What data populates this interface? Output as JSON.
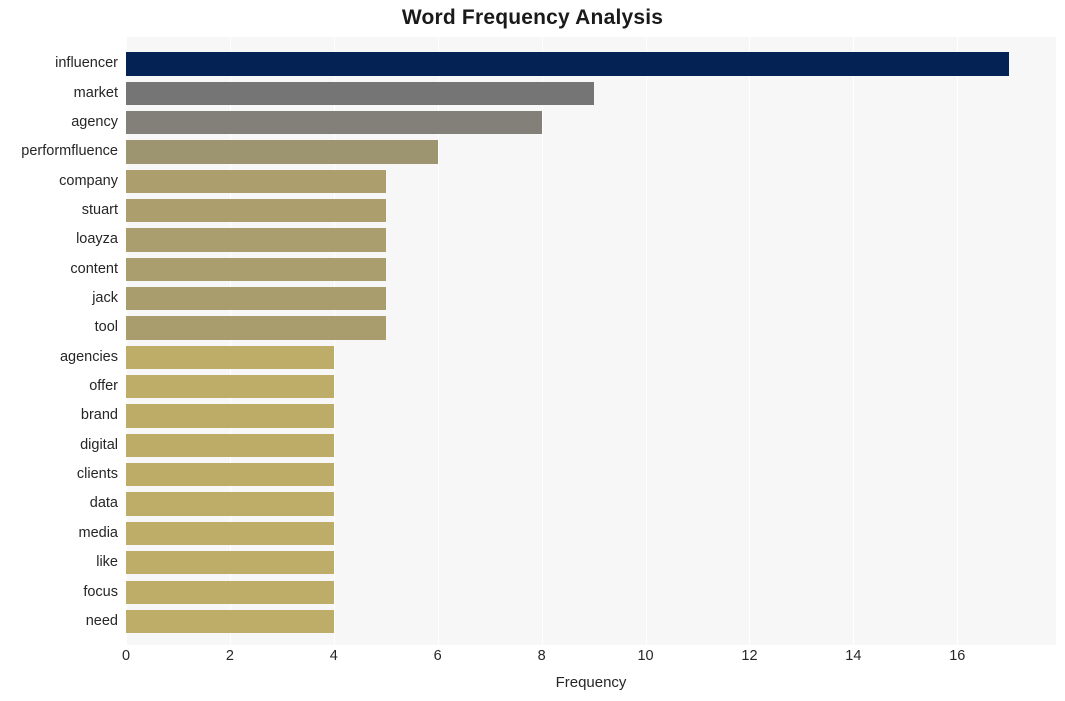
{
  "chart_data": {
    "type": "bar",
    "orientation": "horizontal",
    "title": "Word Frequency Analysis",
    "xlabel": "Frequency",
    "ylabel": "",
    "categories": [
      "influencer",
      "market",
      "agency",
      "performfluence",
      "company",
      "stuart",
      "loayza",
      "content",
      "jack",
      "tool",
      "agencies",
      "offer",
      "brand",
      "digital",
      "clients",
      "data",
      "media",
      "like",
      "focus",
      "need"
    ],
    "values": [
      17,
      9,
      8,
      6,
      5,
      5,
      5,
      5,
      5,
      5,
      4,
      4,
      4,
      4,
      4,
      4,
      4,
      4,
      4,
      4
    ],
    "bar_colors": [
      "#042354",
      "#757575",
      "#828078",
      "#9d9470",
      "#ac9f6d",
      "#ac9f6d",
      "#aa9e6e",
      "#aa9e6e",
      "#a99d6e",
      "#a99d6e",
      "#bdad68",
      "#bdad68",
      "#bcac68",
      "#bcac68",
      "#bcac68",
      "#bdad68",
      "#bdad68",
      "#bdad68",
      "#bdad68",
      "#bdad68"
    ],
    "xticks": [
      0,
      2,
      4,
      6,
      8,
      10,
      12,
      14,
      16
    ],
    "xlim": [
      0,
      17.9
    ],
    "grid": true,
    "grid_axis": "x",
    "legend": "none",
    "plot_background": "#f7f7f7",
    "figure_background": "#ffffff",
    "gridline_color": "#ffffff",
    "text_color": "#262626"
  }
}
